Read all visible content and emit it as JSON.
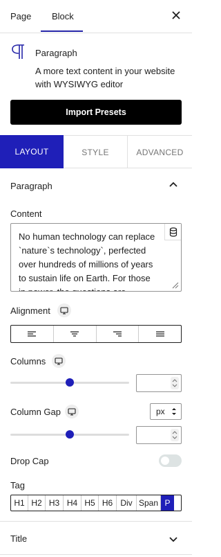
{
  "top_tabs": {
    "page": "Page",
    "block": "Block"
  },
  "block": {
    "title": "Paragraph",
    "description": "A more text content in your website with WYSIWYG editor"
  },
  "import_button": "Import Presets",
  "panel_tabs": {
    "layout": "LAYOUT",
    "style": "STYLE",
    "advanced": "ADVANCED"
  },
  "section": {
    "title": "Paragraph",
    "expanded": true
  },
  "content": {
    "label": "Content",
    "text": "No human technology can replace `nature`s technology`, perfected over hundreds of millions of years to sustain life on Earth. For those in power, the questions are"
  },
  "alignment": {
    "label": "Alignment",
    "options": [
      "left",
      "center",
      "right",
      "justify"
    ]
  },
  "columns": {
    "label": "Columns",
    "value": 0.5
  },
  "column_gap": {
    "label": "Column Gap",
    "unit": "px",
    "value": 0.5
  },
  "drop_cap": {
    "label": "Drop Cap",
    "enabled": false
  },
  "tag": {
    "label": "Tag",
    "options": [
      "H1",
      "H2",
      "H3",
      "H4",
      "H5",
      "H6",
      "Div",
      "Span",
      "P"
    ],
    "selected": "P"
  },
  "title_section": {
    "title": "Title",
    "expanded": false
  },
  "colors": {
    "accent": "#1f1fb8",
    "button": "#000000"
  }
}
